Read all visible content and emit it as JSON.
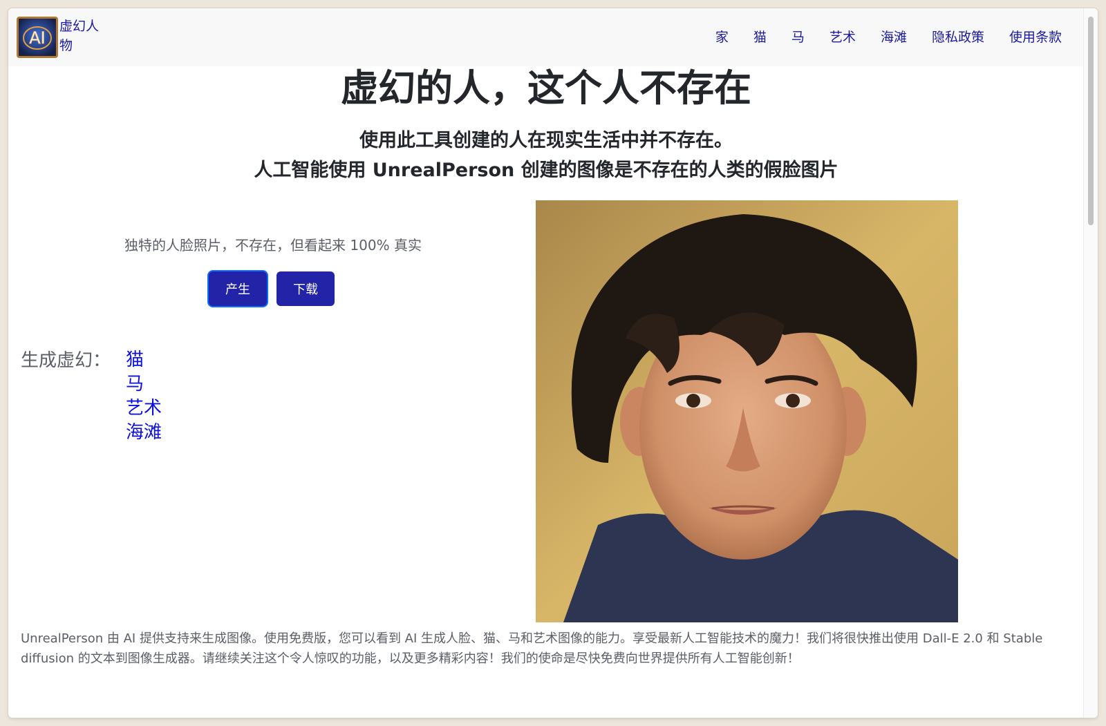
{
  "brand": {
    "name": "虚幻人物",
    "logo_text": "AI"
  },
  "nav": {
    "items": [
      "家",
      "猫",
      "马",
      "艺术",
      "海滩",
      "隐私政策",
      "使用条款"
    ]
  },
  "hero": {
    "title": "虚幻的人，这个人不存在",
    "subtitle1": "使用此工具创建的人在现实生活中并不存在。",
    "subtitle2": "人工智能使用 UnrealPerson 创建的图像是不存在的人类的假脸图片"
  },
  "panel": {
    "tagline": "独特的人脸照片，不存在，但看起来 100% 真实",
    "generate_label": "产生",
    "download_label": "下载"
  },
  "generate_more": {
    "label": "生成虚幻：",
    "links": [
      "猫",
      "马",
      "艺术",
      "海滩"
    ]
  },
  "image": {
    "alt": "AI generated face"
  },
  "footer": {
    "text": "UnrealPerson 由 AI 提供支持来生成图像。使用免费版，您可以看到 AI 生成人脸、猫、马和艺术图像的能力。享受最新人工智能技术的魔力！我们将很快推出使用 Dall-E 2.0 和 Stable diffusion 的文本到图像生成器。请继续关注这个令人惊叹的功能，以及更多精彩内容！我们的使命是尽快免费向世界提供所有人工智能创新！"
  },
  "colors": {
    "accent": "#2323a8",
    "link": "#0b10e0",
    "nav_link": "#1a1aa0",
    "text": "#23262b",
    "muted": "#5a5e66"
  }
}
